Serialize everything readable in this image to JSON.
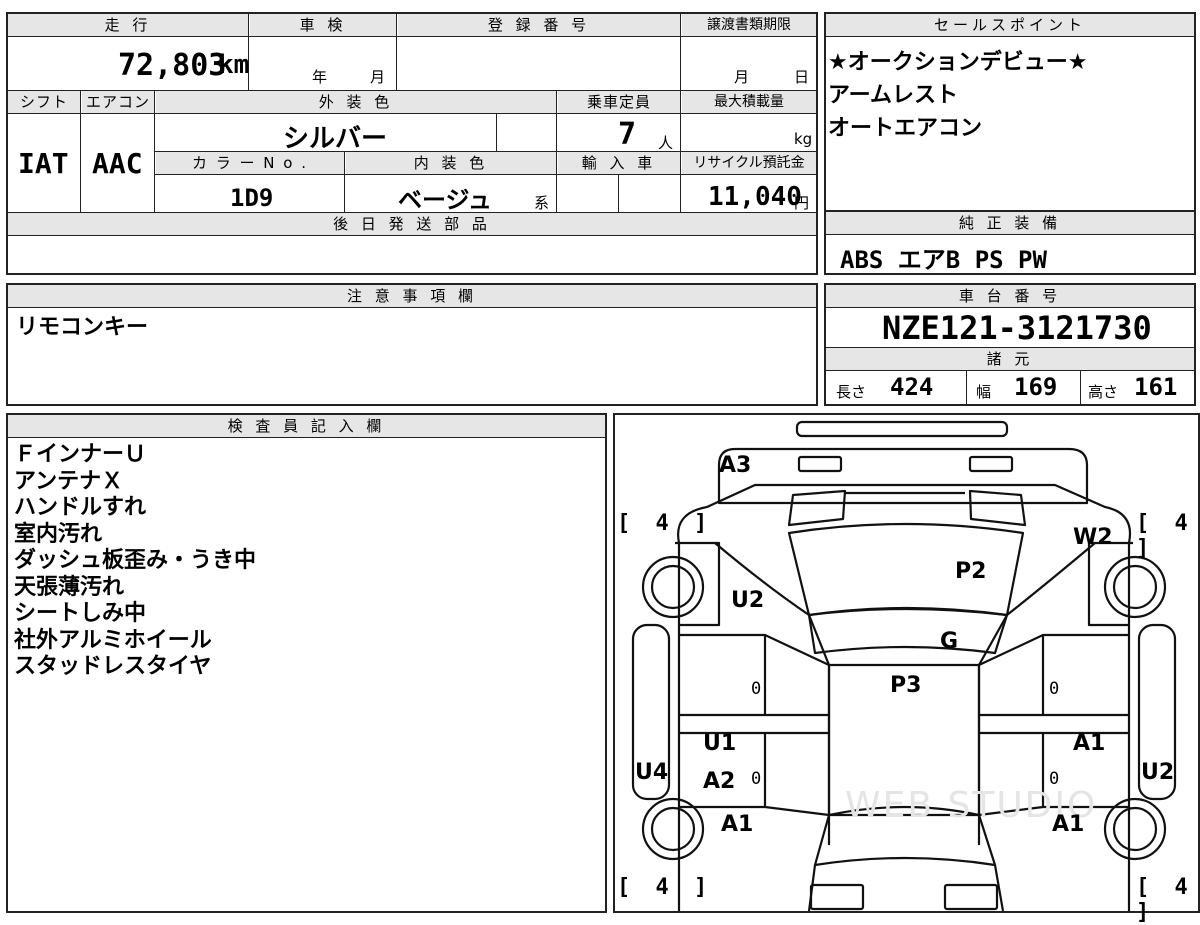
{
  "vehicle": {
    "mileage_header": "走 行",
    "mileage_value": "72,803",
    "mileage_unit": "km",
    "inspection_header": "車 検",
    "inspection_year_label": "年",
    "inspection_month_label": "月",
    "registration_header": "登 録 番 号",
    "transfer_header": "譲渡書類期限",
    "transfer_month_label": "月",
    "transfer_day_label": "日",
    "shift_header": "シフト",
    "shift_value": "IAT",
    "ac_header": "エアコン",
    "ac_value": "AAC",
    "exterior_color_header": "外 装 色",
    "exterior_color_value": "シルバー",
    "capacity_header": "乗車定員",
    "capacity_value": "7",
    "capacity_unit": "人",
    "max_load_header": "最大積載量",
    "max_load_unit": "kg",
    "color_no_header": "カ ラ ー N o .",
    "color_no_value": "1D9",
    "interior_color_header": "内 装 色",
    "interior_color_value": "ベージュ",
    "interior_color_suffix": "系",
    "import_header": "輸 入 車",
    "recycle_header": "リサイクル預託金",
    "recycle_value": "11,040",
    "recycle_unit": "円",
    "later_parts_header": "後 日 発 送 部 品"
  },
  "sales_points": {
    "header": "セールスポイント",
    "lines": [
      "★オークションデビュー★",
      "アームレスト",
      "オートエアコン"
    ]
  },
  "genuine_equipment": {
    "header": "純 正 装 備",
    "value": "ABS エアB PS PW"
  },
  "notes": {
    "header": "注 意 事 項 欄",
    "value": "リモコンキー"
  },
  "chassis": {
    "header": "車 台 番 号",
    "value": "NZE121-3121730",
    "specs_header": "諸 元",
    "length_label": "長さ",
    "length_value": "424",
    "width_label": "幅",
    "width_value": "169",
    "height_label": "高さ",
    "height_value": "161"
  },
  "inspector": {
    "header": "検 査 員 記 入 欄",
    "lines": [
      "ＦインナーＵ",
      "アンテナＸ",
      "ハンドルすれ",
      "室内汚れ",
      "ダッシュ板歪み・うき中",
      "天張薄汚れ",
      "シートしみ中",
      "社外アルミホイール",
      "スタッドレスタイヤ"
    ]
  },
  "diagram": {
    "marks": {
      "a3": "A3",
      "w2": "W2",
      "p2": "P2",
      "u2_left": "U2",
      "g": "G",
      "p3": "P3",
      "u1": "U1",
      "a1_right_door": "A1",
      "u4": "U4",
      "a2": "A2",
      "u2_right": "U2",
      "a1_left_rear": "A1",
      "a1_right_rear": "A1"
    },
    "tire_tread": "[ 4 ]",
    "zero": "0",
    "watermark": "WEB STUDIO"
  }
}
